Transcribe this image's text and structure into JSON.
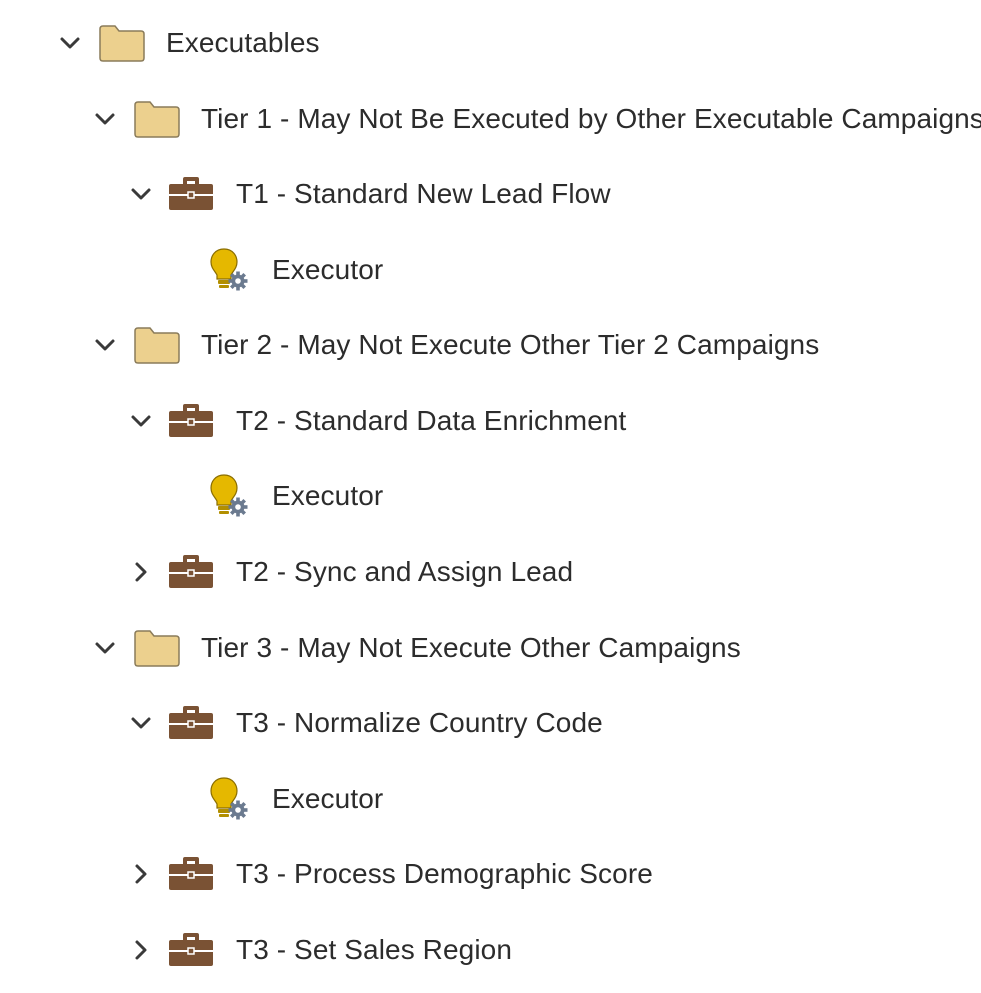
{
  "tree": {
    "root": {
      "label": "Executables",
      "expanded": true,
      "icon": "folder-icon"
    },
    "tier1": {
      "label": "Tier 1 - May Not Be Executed by Other Executable Campaigns",
      "expanded": true,
      "icon": "folder-icon"
    },
    "t1_flow": {
      "label": "T1 - Standard New Lead Flow",
      "expanded": true,
      "icon": "briefcase-icon"
    },
    "t1_exec": {
      "label": "Executor",
      "icon": "lightbulb-gear-icon"
    },
    "tier2": {
      "label": "Tier 2 - May Not Execute Other Tier 2 Campaigns",
      "expanded": true,
      "icon": "folder-icon"
    },
    "t2_enrich": {
      "label": "T2 - Standard Data Enrichment",
      "expanded": true,
      "icon": "briefcase-icon"
    },
    "t2_exec": {
      "label": "Executor",
      "icon": "lightbulb-gear-icon"
    },
    "t2_sync": {
      "label": "T2 - Sync and Assign Lead",
      "expanded": false,
      "icon": "briefcase-icon"
    },
    "tier3": {
      "label": "Tier 3 - May Not Execute Other Campaigns",
      "expanded": true,
      "icon": "folder-icon"
    },
    "t3_norm": {
      "label": "T3 - Normalize Country Code",
      "expanded": true,
      "icon": "briefcase-icon"
    },
    "t3_exec": {
      "label": "Executor",
      "icon": "lightbulb-gear-icon"
    },
    "t3_demo": {
      "label": "T3 - Process Demographic Score",
      "expanded": false,
      "icon": "briefcase-icon"
    },
    "t3_region": {
      "label": "T3 - Set Sales Region",
      "expanded": false,
      "icon": "briefcase-icon"
    }
  },
  "colors": {
    "folder_fill": "#ecd08e",
    "folder_stroke": "#8a7b5a",
    "briefcase": "#7a5234",
    "bulb": "#e5b800",
    "gear": "#6b7a8f",
    "chevron": "#3a3a3a",
    "text": "#2c2c2c"
  }
}
